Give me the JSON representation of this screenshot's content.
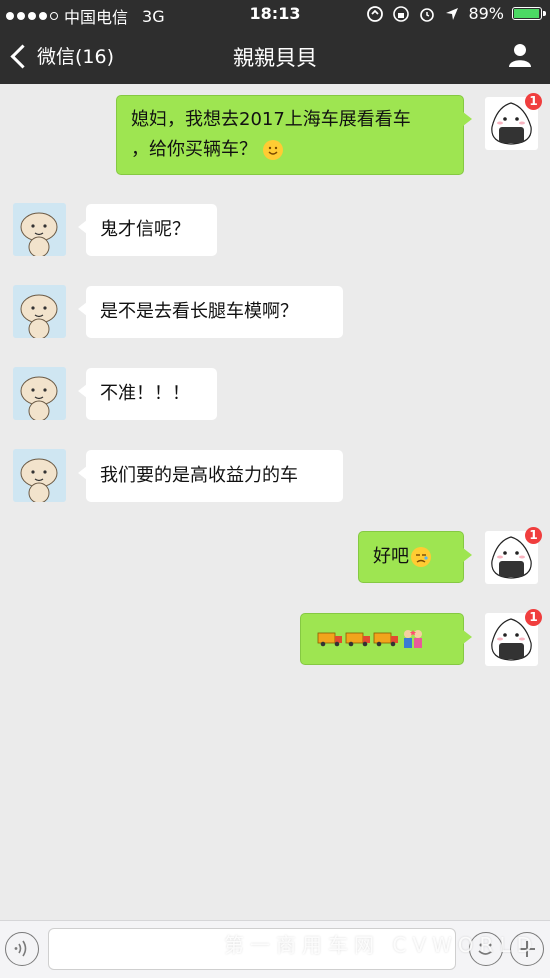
{
  "status_bar": {
    "carrier": "中国电信",
    "network": "3G",
    "time": "18:13",
    "battery": "89%",
    "battery_level": 0.89
  },
  "nav": {
    "back_label": "微信(16)",
    "title": "親親貝貝"
  },
  "messages": [
    {
      "side": "out",
      "text": "媳妇，我想去2017上海车展看看车，给你买辆车？",
      "line1": "媳妇，我想去2017上海车展看看车",
      "line2": "，给你买辆车？",
      "emoji": "smile-emoji"
    },
    {
      "side": "in",
      "text": "鬼才信呢？"
    },
    {
      "side": "in",
      "text": "是不是去看长腿车模啊？"
    },
    {
      "side": "in",
      "text": "不准！！！"
    },
    {
      "side": "in",
      "text": "我们要的是高收益力的车"
    },
    {
      "side": "out",
      "text": "好吧",
      "emoji": "sad-emoji"
    },
    {
      "side": "out",
      "text": "",
      "emoji": "truck-emoji x3, couple-emoji"
    }
  ],
  "avatar_badge": "1",
  "watermark": "第一商用车网 CVWORLD",
  "icons": {
    "back": "chevron-left-icon",
    "profile": "person-icon",
    "voice": "voice-icon",
    "emoji": "emoji-icon",
    "plus": "plus-icon"
  },
  "colors": {
    "bar": "#2e2e2e",
    "background": "#ebebeb",
    "outgoing_bubble": "#9ee551",
    "incoming_bubble": "#ffffff",
    "badge": "#f03e3e"
  }
}
